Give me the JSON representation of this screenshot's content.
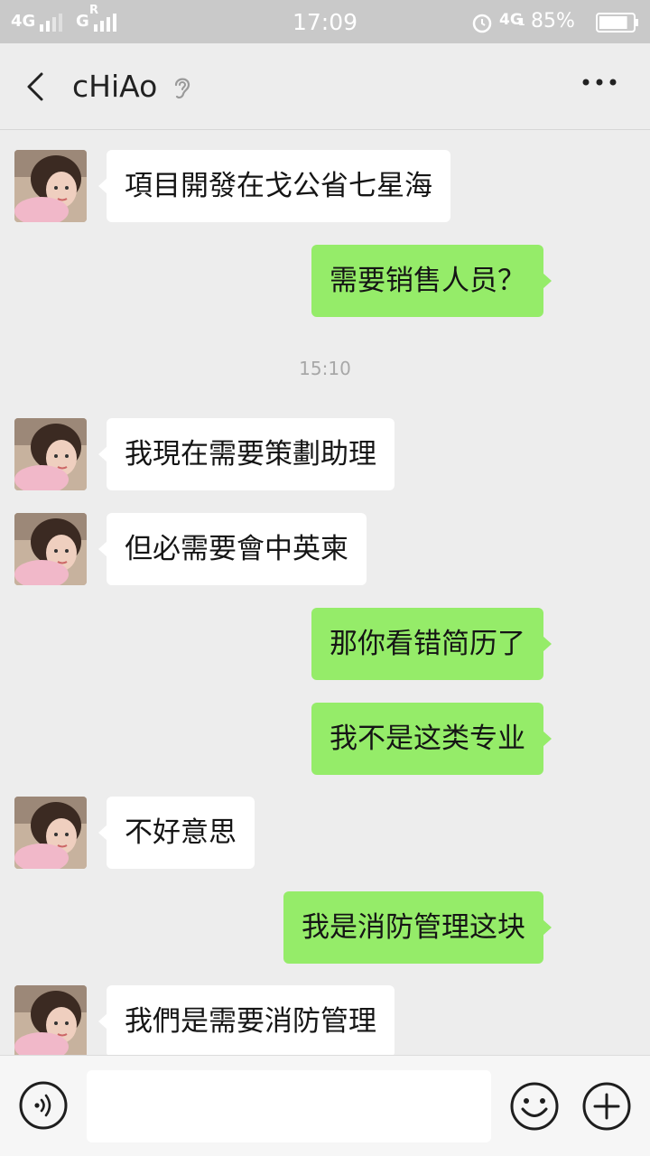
{
  "status_bar": {
    "network1": "4G",
    "network2": "G",
    "network2_sup": "R",
    "time": "17:09",
    "network3": "4G",
    "network3_sub": "1",
    "battery_percent": "85%",
    "battery_level": 0.85
  },
  "header": {
    "title": "cHiAo",
    "icons": {
      "back": "back-arrow-icon",
      "ear": "ear-icon",
      "more": "more-icon"
    }
  },
  "chat": {
    "messages": [
      {
        "side": "in",
        "text": "項目開發在戈公省七星海"
      },
      {
        "side": "out",
        "text": "需要销售人员？"
      },
      {
        "timestamp": "15:10"
      },
      {
        "side": "in",
        "text": "我現在需要策劃助理"
      },
      {
        "side": "in",
        "text": "但必需要會中英柬"
      },
      {
        "side": "out",
        "text": "那你看错简历了"
      },
      {
        "side": "out",
        "text": "我不是这类专业"
      },
      {
        "side": "in",
        "text": "不好意思"
      },
      {
        "side": "out",
        "text": "我是消防管理这块"
      },
      {
        "side": "in",
        "text": "我們是需要消防管理"
      }
    ]
  },
  "input_bar": {
    "value": "",
    "placeholder": "",
    "icons": {
      "voice": "voice-icon",
      "emoji": "emoji-icon",
      "plus": "plus-icon"
    }
  },
  "colors": {
    "sent_bubble": "#95ec69",
    "received_bubble": "#ffffff",
    "background": "#ededed",
    "status_bar": "#c9c9c9"
  }
}
